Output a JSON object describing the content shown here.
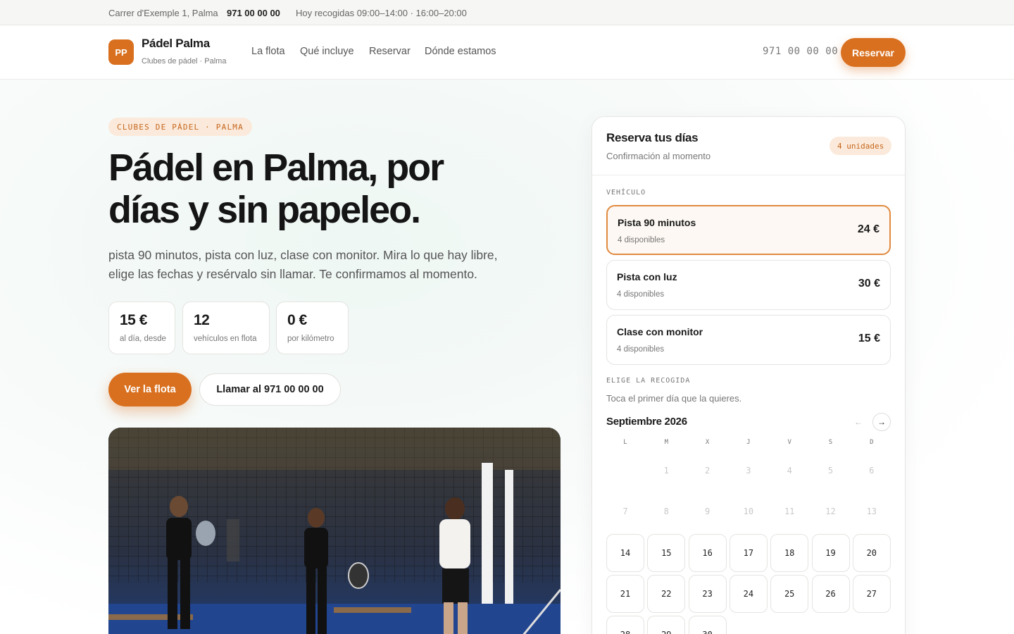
{
  "topbar": {
    "address": "Carrer d'Exemple 1, Palma",
    "phone": "971 00 00 00",
    "hours": "Hoy recogidas 09:00–14:00 · 16:00–20:00"
  },
  "header": {
    "logo_initials": "PP",
    "brand": "Pádel Palma",
    "brand_sub": "Clubes de pádel · Palma",
    "nav": [
      "La flota",
      "Qué incluye",
      "Reservar",
      "Dónde estamos"
    ],
    "phone": "971 00 00 00",
    "reserve_label": "Reservar"
  },
  "hero": {
    "pill": "CLUBES DE PÁDEL · PALMA",
    "title_line1": "Pádel en Palma, por",
    "title_line2": "días y sin papeleo.",
    "lead": "pista 90 minutos, pista con luz, clase con monitor. Mira lo que hay libre, elige las fechas y resérvalo sin llamar. Te confirmamos al momento.",
    "stats": [
      {
        "value": "15 €",
        "label": "al día, desde"
      },
      {
        "value": "12",
        "label": "vehículos en flota"
      },
      {
        "value": "0 €",
        "label": "por kilómetro"
      }
    ],
    "btn_primary": "Ver la flota",
    "btn_secondary": "Llamar al 971 00 00 00"
  },
  "booking": {
    "title": "Reserva tus días",
    "subtitle": "Confirmación al momento",
    "units_badge": "4 unidades",
    "vehicle_label": "VEHÍCULO",
    "options": [
      {
        "name": "Pista 90 minutos",
        "avail": "4 disponibles",
        "price": "24 €",
        "selected": true
      },
      {
        "name": "Pista con luz",
        "avail": "4 disponibles",
        "price": "30 €",
        "selected": false
      },
      {
        "name": "Clase con monitor",
        "avail": "4 disponibles",
        "price": "15 €",
        "selected": false
      }
    ],
    "pickup_label": "ELIGE LA RECOGIDA",
    "pickup_hint": "Toca el primer día que la quieres.",
    "month": "Septiembre 2026",
    "prev_icon": "arrow-left-icon",
    "next_icon": "arrow-right-icon",
    "prev_glyph": "←",
    "next_glyph": "→",
    "weekdays": [
      "L",
      "M",
      "X",
      "J",
      "V",
      "S",
      "D"
    ],
    "days": [
      [
        "",
        "1",
        "2",
        "3",
        "4",
        "5",
        "6"
      ],
      [
        "7",
        "8",
        "9",
        "10",
        "11",
        "12",
        "13"
      ],
      [
        "14",
        "15",
        "16",
        "17",
        "18",
        "19",
        "20"
      ],
      [
        "21",
        "22",
        "23",
        "24",
        "25",
        "26",
        "27"
      ],
      [
        "28",
        "29",
        "30",
        "",
        "",
        "",
        ""
      ]
    ],
    "first_available_day": 14
  },
  "colors": {
    "accent": "#d9701f",
    "accent_soft": "#fbeadb",
    "text": "#1a1a1a"
  }
}
